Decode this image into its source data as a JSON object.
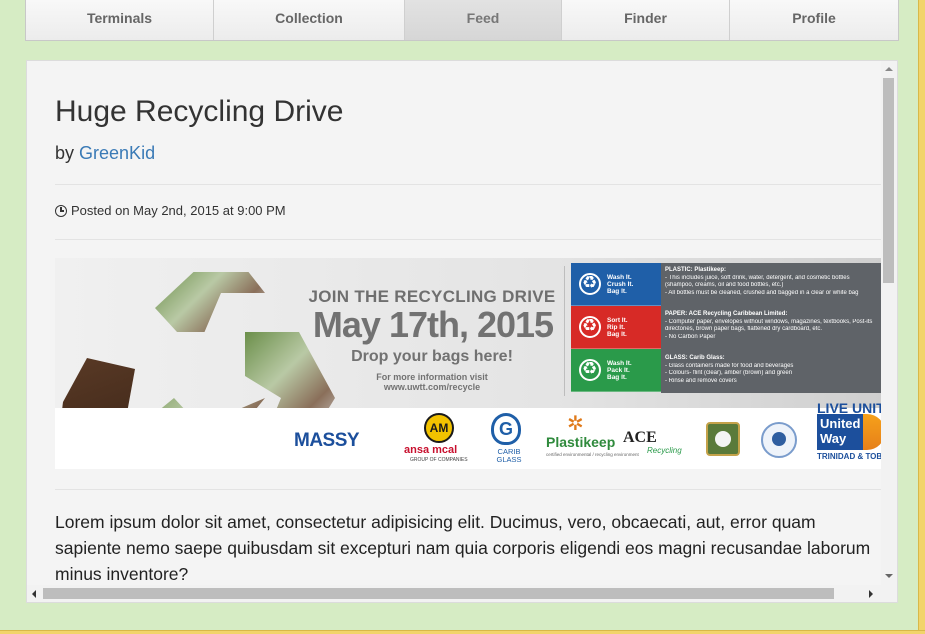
{
  "tabs": [
    {
      "label": "Terminals",
      "active": false
    },
    {
      "label": "Collection",
      "active": false
    },
    {
      "label": "Feed",
      "active": true
    },
    {
      "label": "Finder",
      "active": false
    },
    {
      "label": "Profile",
      "active": false
    }
  ],
  "post": {
    "title": "Huge Recycling Drive",
    "by_prefix": "by",
    "author": "GreenKid",
    "posted": "Posted on May 2nd, 2015 at 9:00 PM",
    "body": "Lorem ipsum dolor sit amet, consectetur adipisicing elit. Ducimus, vero, obcaecati, aut, error quam sapiente nemo saepe quibusdam sit excepturi nam quia corporis eligendi eos magni recusandae laborum minus inventore?"
  },
  "banner": {
    "join": "JOIN THE RECYCLING DRIVE",
    "date": "May 17th, 2015",
    "drop": "Drop your bags here!",
    "more_1": "For more information visit",
    "more_2": "www.uwtt.com/recycle",
    "bins": [
      {
        "l1": "Wash It.",
        "l2": "Crush It.",
        "l3": "Bag It.",
        "color": "#1f5fa8"
      },
      {
        "l1": "Sort It.",
        "l2": "Rip It.",
        "l3": "Bag It.",
        "color": "#d72a26"
      },
      {
        "l1": "Wash It.",
        "l2": "Pack It.",
        "l3": "Bag It.",
        "color": "#2a9a4a"
      }
    ],
    "info": [
      {
        "head": "PLASTIC: Plastikeep:",
        "lines": [
          "- This includes juice, soft drink, water, detergent, and cosmetic bottles",
          "  (shampoo, creams, oil and food bottles, etc.)",
          "- All bottles must be cleaned, crushed and bagged in a clear or white bag"
        ]
      },
      {
        "head": "PAPER: ACE Recycling Caribbean Limited:",
        "lines": [
          "- Computer paper, envelopes without windows, magazines, textbooks, Post-its",
          "  directories, brown paper bags, flattened dry cardboard, etc.",
          "- No Carbon Paper"
        ]
      },
      {
        "head": "GLASS: Carib Glass:",
        "lines": [
          "- Glass containers made for food and beverages",
          "- Colours- flint (clear), amber (brown) and green",
          "- Rinse and remove covers"
        ]
      }
    ],
    "sponsors": {
      "massy": "MASSY",
      "ansa_mark": "AM",
      "ansa": "ansa mcal",
      "ansa_sub": "GROUP OF COMPANIES",
      "carib_mark": "G",
      "carib_1": "CARIB",
      "carib_2": "GLASS",
      "plastikeep": "Plastikeep",
      "plastikeep_sub": "certified environmental / recycling environment",
      "ace": "ACE",
      "ace_sub": "Recycling",
      "uw_live": "LIVE UNITED",
      "uw_1": "United",
      "uw_2": "Way",
      "uw_tt": "TRINIDAD & TOBAGO"
    }
  }
}
